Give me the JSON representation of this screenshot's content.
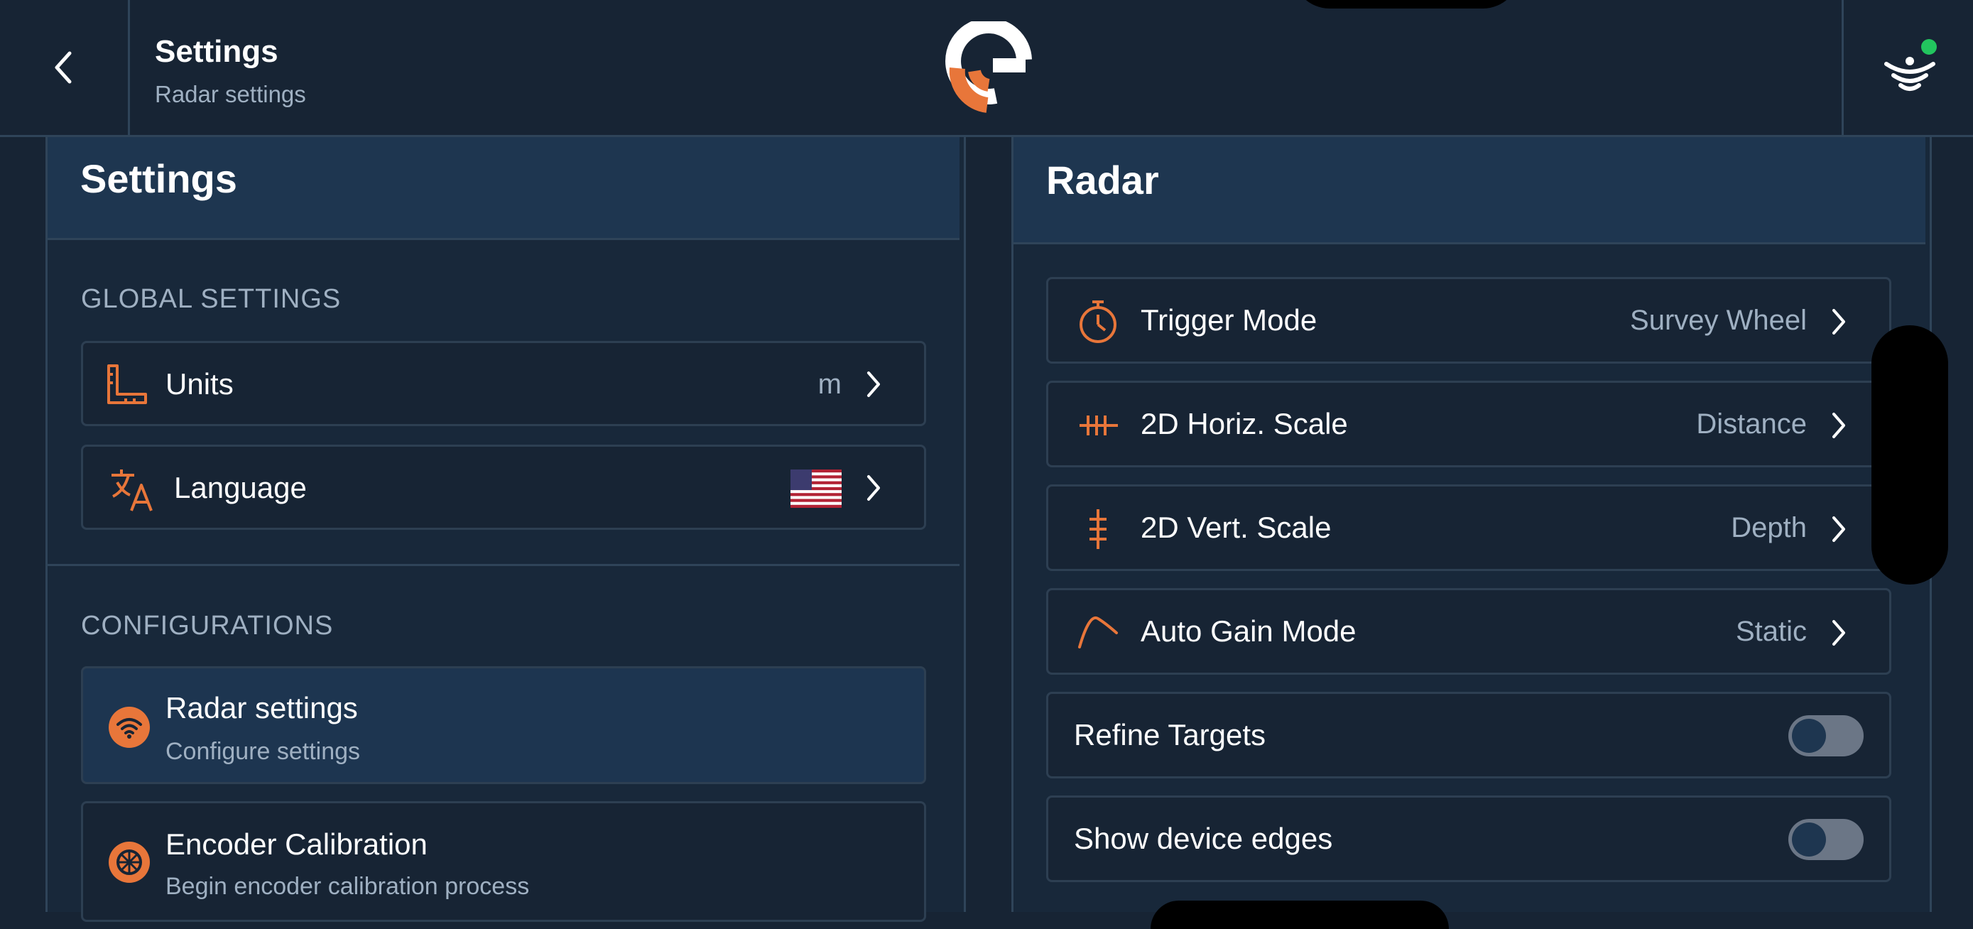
{
  "header": {
    "title": "Settings",
    "subtitle": "Radar settings",
    "back_icon": "chevron-left-icon",
    "logo": "brand-logo",
    "status_icon": "wireless-signal-icon",
    "status_dot_color": "#22c55e"
  },
  "left_panel": {
    "title": "Settings",
    "global_section_label": "GLOBAL SETTINGS",
    "global_items": [
      {
        "label": "Units",
        "value": "m",
        "icon": "ruler-icon"
      },
      {
        "label": "Language",
        "value": "",
        "icon": "translate-icon",
        "flag": "us-flag"
      }
    ],
    "config_section_label": "CONFIGURATIONS",
    "config_items": [
      {
        "label": "Radar settings",
        "sublabel": "Configure settings",
        "icon": "radar-wifi-icon",
        "selected": true
      },
      {
        "label": "Encoder Calibration",
        "sublabel": "Begin encoder calibration process",
        "icon": "wheel-icon",
        "selected": false
      }
    ]
  },
  "right_panel": {
    "title": "Radar",
    "items": [
      {
        "label": "Trigger Mode",
        "value": "Survey Wheel",
        "icon": "stopwatch-icon"
      },
      {
        "label": "2D Horiz. Scale",
        "value": "Distance",
        "icon": "horizontal-scale-icon"
      },
      {
        "label": "2D Vert. Scale",
        "value": "Depth",
        "icon": "vertical-scale-icon"
      },
      {
        "label": "Auto Gain Mode",
        "value": "Static",
        "icon": "gain-curve-icon"
      }
    ],
    "toggles": [
      {
        "label": "Refine Targets",
        "on": false
      },
      {
        "label": "Show device edges",
        "on": false
      }
    ]
  },
  "colors": {
    "background": "#172434",
    "panel_header": "#1e3650",
    "accent": "#e8763a",
    "text_secondary": "#9fb0c2"
  }
}
